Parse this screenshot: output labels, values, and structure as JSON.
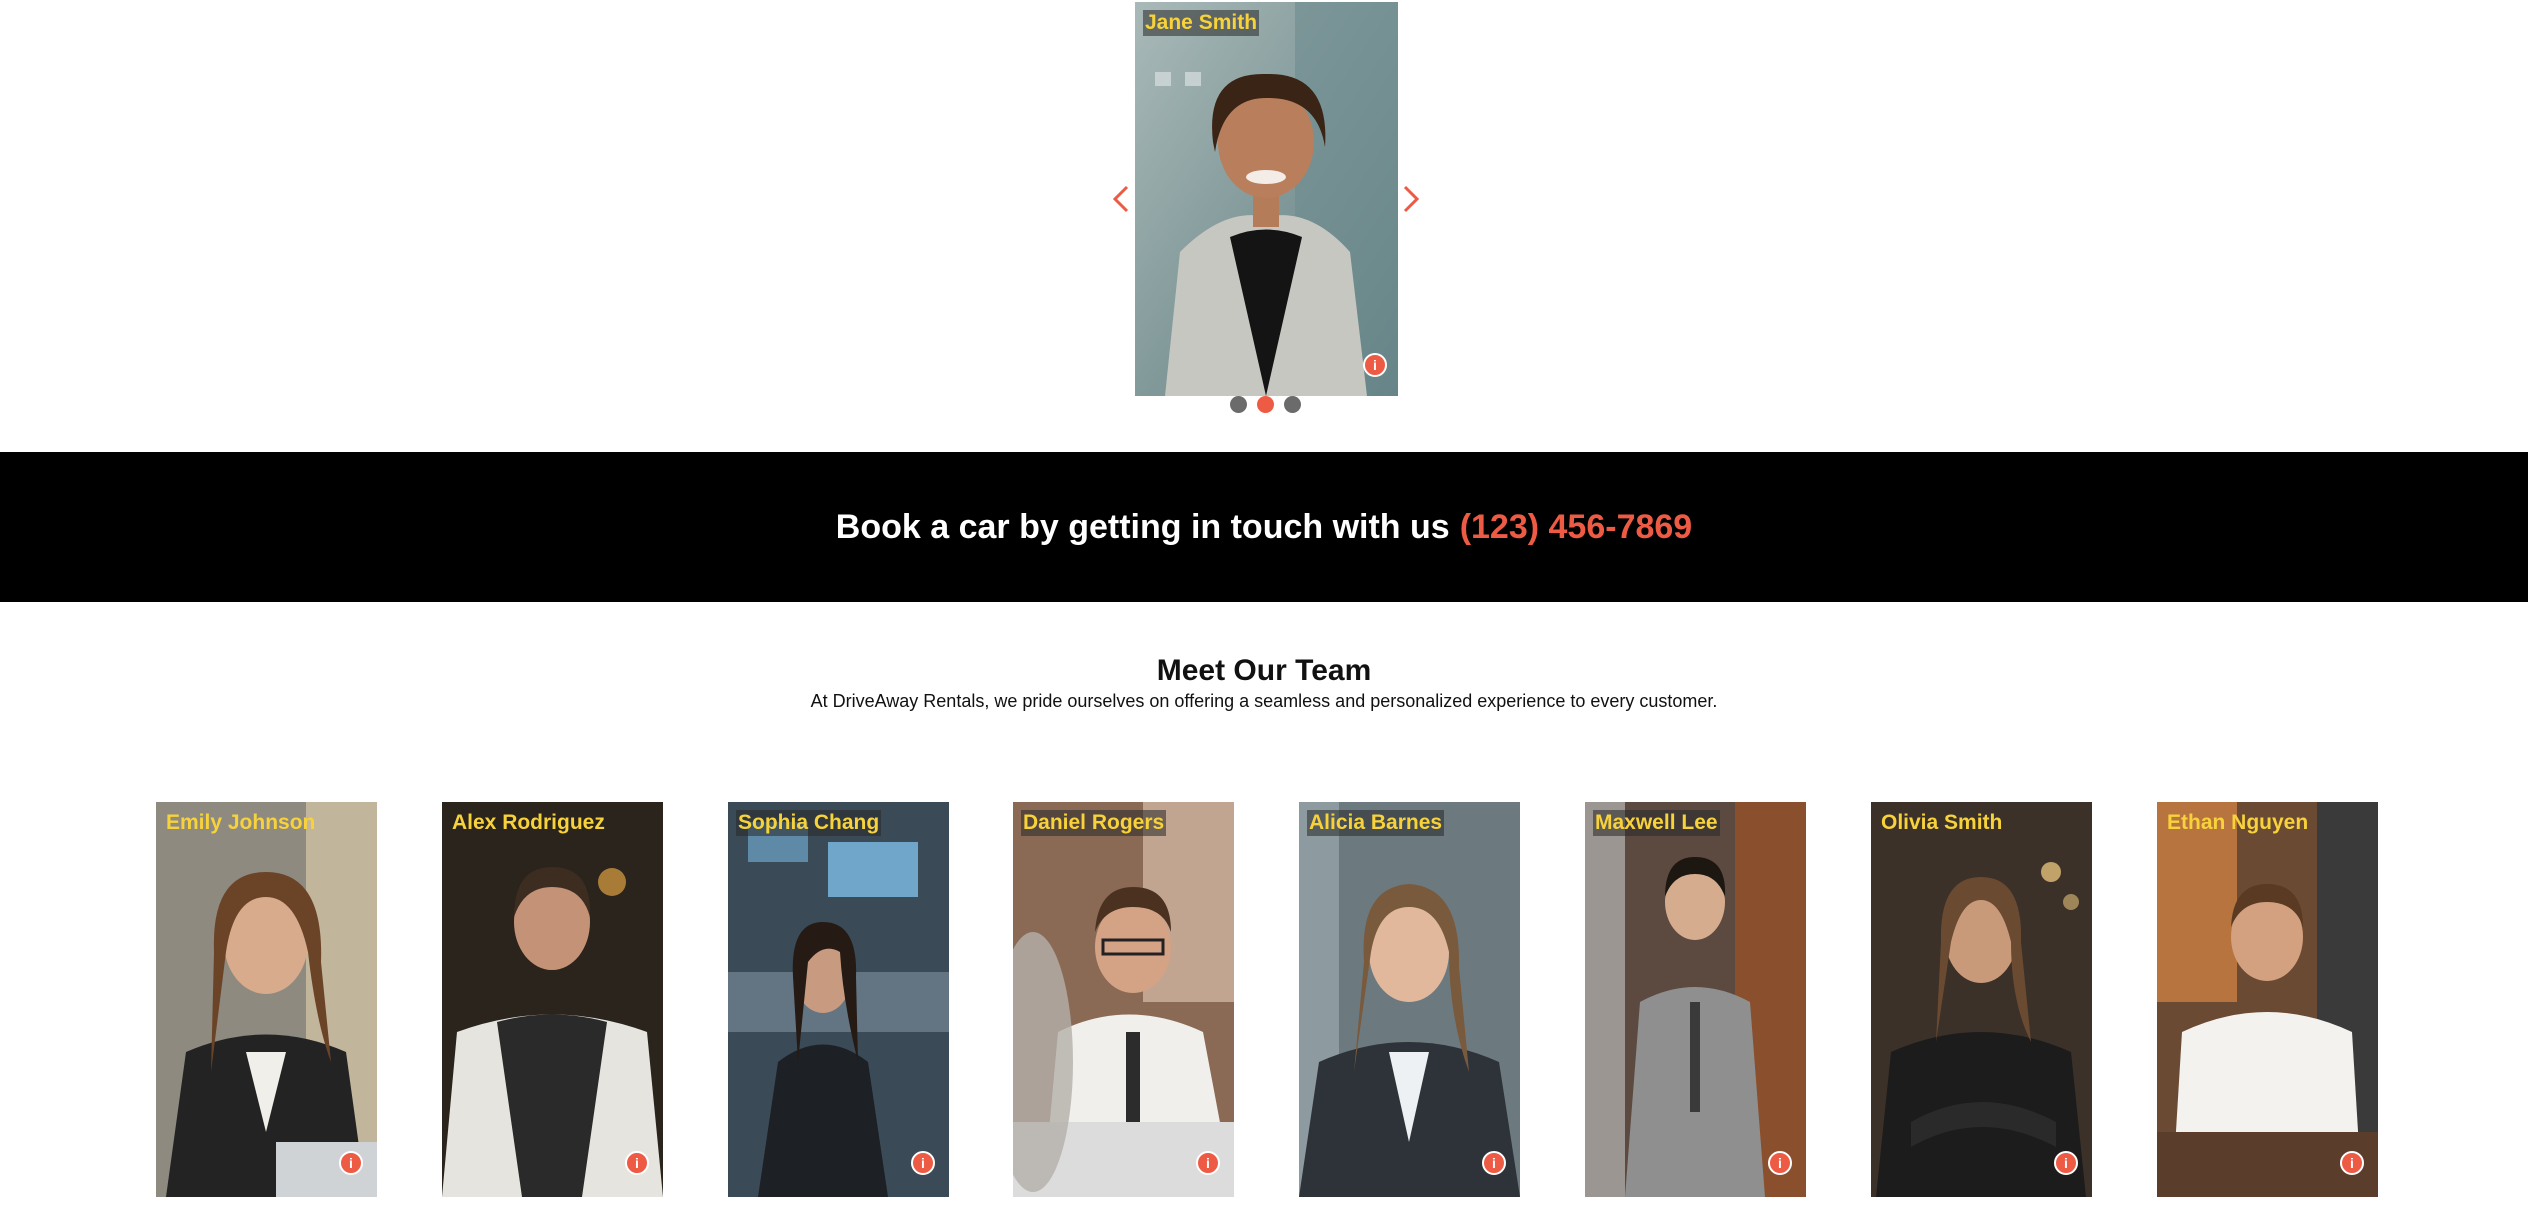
{
  "carousel": {
    "slide": {
      "name": "Jane Smith",
      "info_icon": "info-icon"
    },
    "prev_icon": "chevron-left-icon",
    "next_icon": "chevron-right-icon",
    "dots_count": 3,
    "active_dot": 2
  },
  "cta": {
    "text": "Book a car by getting in touch with us",
    "phone": "(123) 456-7869"
  },
  "team": {
    "title": "Meet Our Team",
    "subtitle": "At DriveAway Rentals, we pride ourselves on offering a seamless and personalized experience to every customer.",
    "members": [
      {
        "name": "Emily Johnson"
      },
      {
        "name": "Alex Rodriguez"
      },
      {
        "name": "Sophia Chang"
      },
      {
        "name": "Daniel Rogers"
      },
      {
        "name": "Alicia Barnes"
      },
      {
        "name": "Maxwell Lee"
      },
      {
        "name": "Olivia Smith"
      },
      {
        "name": "Ethan Nguyen"
      }
    ]
  },
  "colors": {
    "accent": "#ee5b45",
    "name_label": "#f7d23a",
    "banner_bg": "#000000",
    "dot_inactive": "#6b6b6b"
  },
  "info_badge_glyph": "i"
}
